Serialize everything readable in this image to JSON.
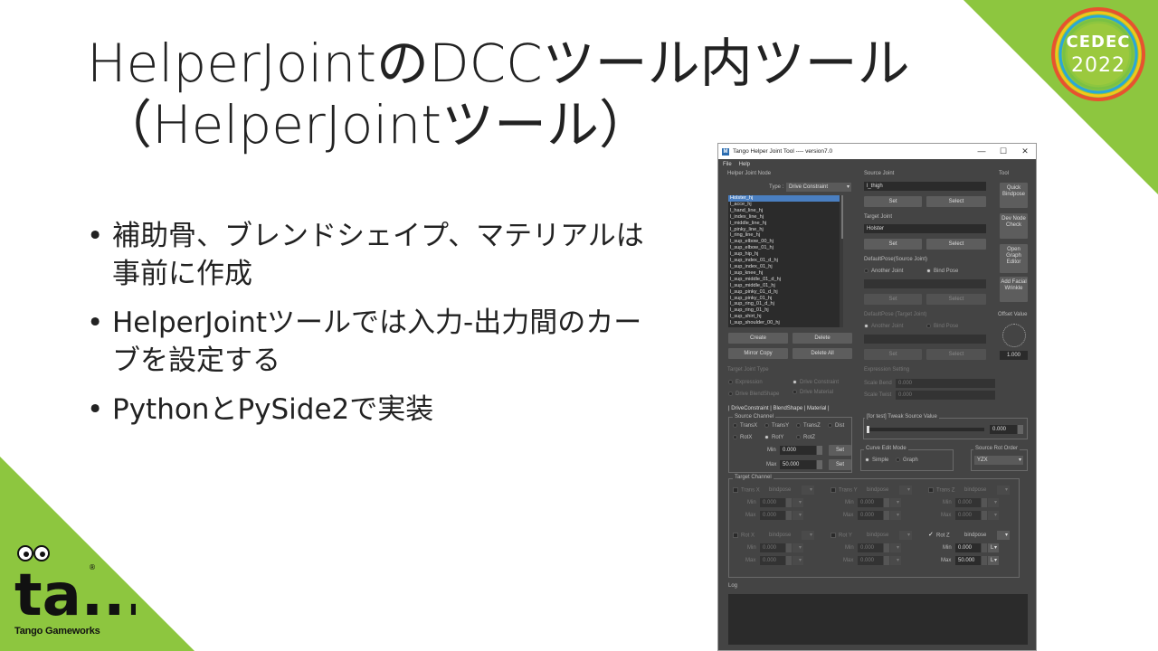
{
  "slide": {
    "title_line1": "HelperJointのDCCツール内ツール",
    "title_line2": "（HelperJointツール）",
    "bullets": [
      "補助骨、ブレンドシェイプ、マテリアルは事前に作成",
      "HelperJointツールでは入力-出力間のカーブを設定する",
      "PythonとPySide2で実装"
    ],
    "accent_color": "#8dc63f",
    "event_logo": {
      "line1": "CEDEC",
      "line2": "2022"
    },
    "company_logo": {
      "mark": "ta...",
      "name": "Tango Gameworks",
      "registered": "®"
    }
  },
  "window": {
    "app_icon": "M",
    "title": "Tango Helper Joint Tool ---- version7.0",
    "controls": {
      "minimize": "—",
      "maximize": "☐",
      "close": "✕"
    },
    "menu": [
      "File",
      "Help"
    ],
    "helper_joint_node": {
      "heading": "Helper Joint Node",
      "type_label": "Type :",
      "type_value": "Drive Constraint",
      "nodes": [
        "Holster_hj",
        "l_acce_hj",
        "l_hand_line_hj",
        "l_index_line_hj",
        "l_middle_line_hj",
        "l_pinky_line_hj",
        "l_ring_line_hj",
        "l_sup_elbow_00_hj",
        "l_sup_elbow_01_hj",
        "l_sup_hip_hj",
        "l_sup_index_01_d_hj",
        "l_sup_index_01_hj",
        "l_sup_knee_hj",
        "l_sup_middle_01_d_hj",
        "l_sup_middle_01_hj",
        "l_sup_pinky_01_d_hj",
        "l_sup_pinky_01_hj",
        "l_sup_ring_01_d_hj",
        "l_sup_ring_01_hj",
        "l_sup_shirt_hj",
        "l_sup_shoulder_00_hj"
      ],
      "buttons": {
        "create": "Create",
        "delete": "Delete",
        "mirror_copy": "Mirror Copy",
        "delete_all": "Delete All"
      }
    },
    "source_joint": {
      "heading": "Source Joint",
      "value": "l_thigh",
      "set": "Set",
      "select": "Select"
    },
    "target_joint": {
      "heading": "Target Joint",
      "value": "Holster",
      "set": "Set",
      "select": "Select"
    },
    "default_pose_source": {
      "heading": "DefaultPose(Source Joint)",
      "another": "Another Joint",
      "bind": "Bind Pose",
      "set": "Set",
      "select": "Select"
    },
    "default_pose_target": {
      "heading": "DefaultPose (Target Joint)",
      "another": "Another Joint",
      "bind": "Bind Pose",
      "set": "Set",
      "select": "Select"
    },
    "tool": {
      "heading": "Tool",
      "quick_bindpose": "Quick Bindpose",
      "dev_node_check": "Dev Node Check",
      "open_graph_editor": "Open Graph Editor",
      "add_facial_wrinkle": "Add Facial Wrinkle"
    },
    "offset": {
      "label": "Offset Value",
      "value": "1.000"
    },
    "target_joint_type": {
      "heading": "Target Joint Type",
      "expression": "Expression",
      "drive_constraint": "Drive Constraint",
      "drive_blendshape": "Drive BlendShape",
      "drive_material": "Drive Material"
    },
    "expression_setting": {
      "heading": "Expression Setting",
      "scale_bend": "Scale Bend",
      "scale_bend_value": "0.000",
      "scale_twist": "Scale Twist",
      "scale_twist_value": "0.000"
    },
    "tabs_label": "| DriveConstraint | BlendShape | Material |",
    "source_channel": {
      "heading": "Source Channel",
      "options": [
        "TransX",
        "TransY",
        "TransZ",
        "Dist",
        "RotX",
        "RotY",
        "RotZ"
      ],
      "selected": "RotY",
      "min_label": "Min",
      "min_value": "0.000",
      "max_label": "Max",
      "max_value": "50.000",
      "set": "Set"
    },
    "tweak": {
      "heading": "[for test] Tweak Source Value",
      "value": "0.000",
      "level": 0
    },
    "curve_edit_mode": {
      "heading": "Curve Edit Mode",
      "simple": "Simple",
      "graph": "Graph",
      "selected": "Simple"
    },
    "source_rot_order": {
      "heading": "Source Rot Order",
      "value": "YZX"
    },
    "target_channel": {
      "heading": "Target Channel",
      "channels": [
        {
          "name": "Trans X",
          "mode": "bindpose",
          "min": "0.000",
          "max": "0.000",
          "checked": false
        },
        {
          "name": "Trans Y",
          "mode": "bindpose",
          "min": "0.000",
          "max": "0.000",
          "checked": false
        },
        {
          "name": "Trans Z",
          "mode": "bindpose",
          "min": "0.000",
          "max": "0.000",
          "checked": false
        },
        {
          "name": "Rot X",
          "mode": "bindpose",
          "min": "0.000",
          "max": "0.000",
          "checked": false
        },
        {
          "name": "Rot Y",
          "mode": "bindpose",
          "min": "0.000",
          "max": "0.000",
          "checked": false
        },
        {
          "name": "Rot Z",
          "mode": "bindpose",
          "min": "0.000",
          "max": "50.000",
          "checked": true
        }
      ],
      "min_label": "Min",
      "max_label": "Max",
      "interp": "L"
    },
    "log": {
      "heading": "Log"
    }
  }
}
